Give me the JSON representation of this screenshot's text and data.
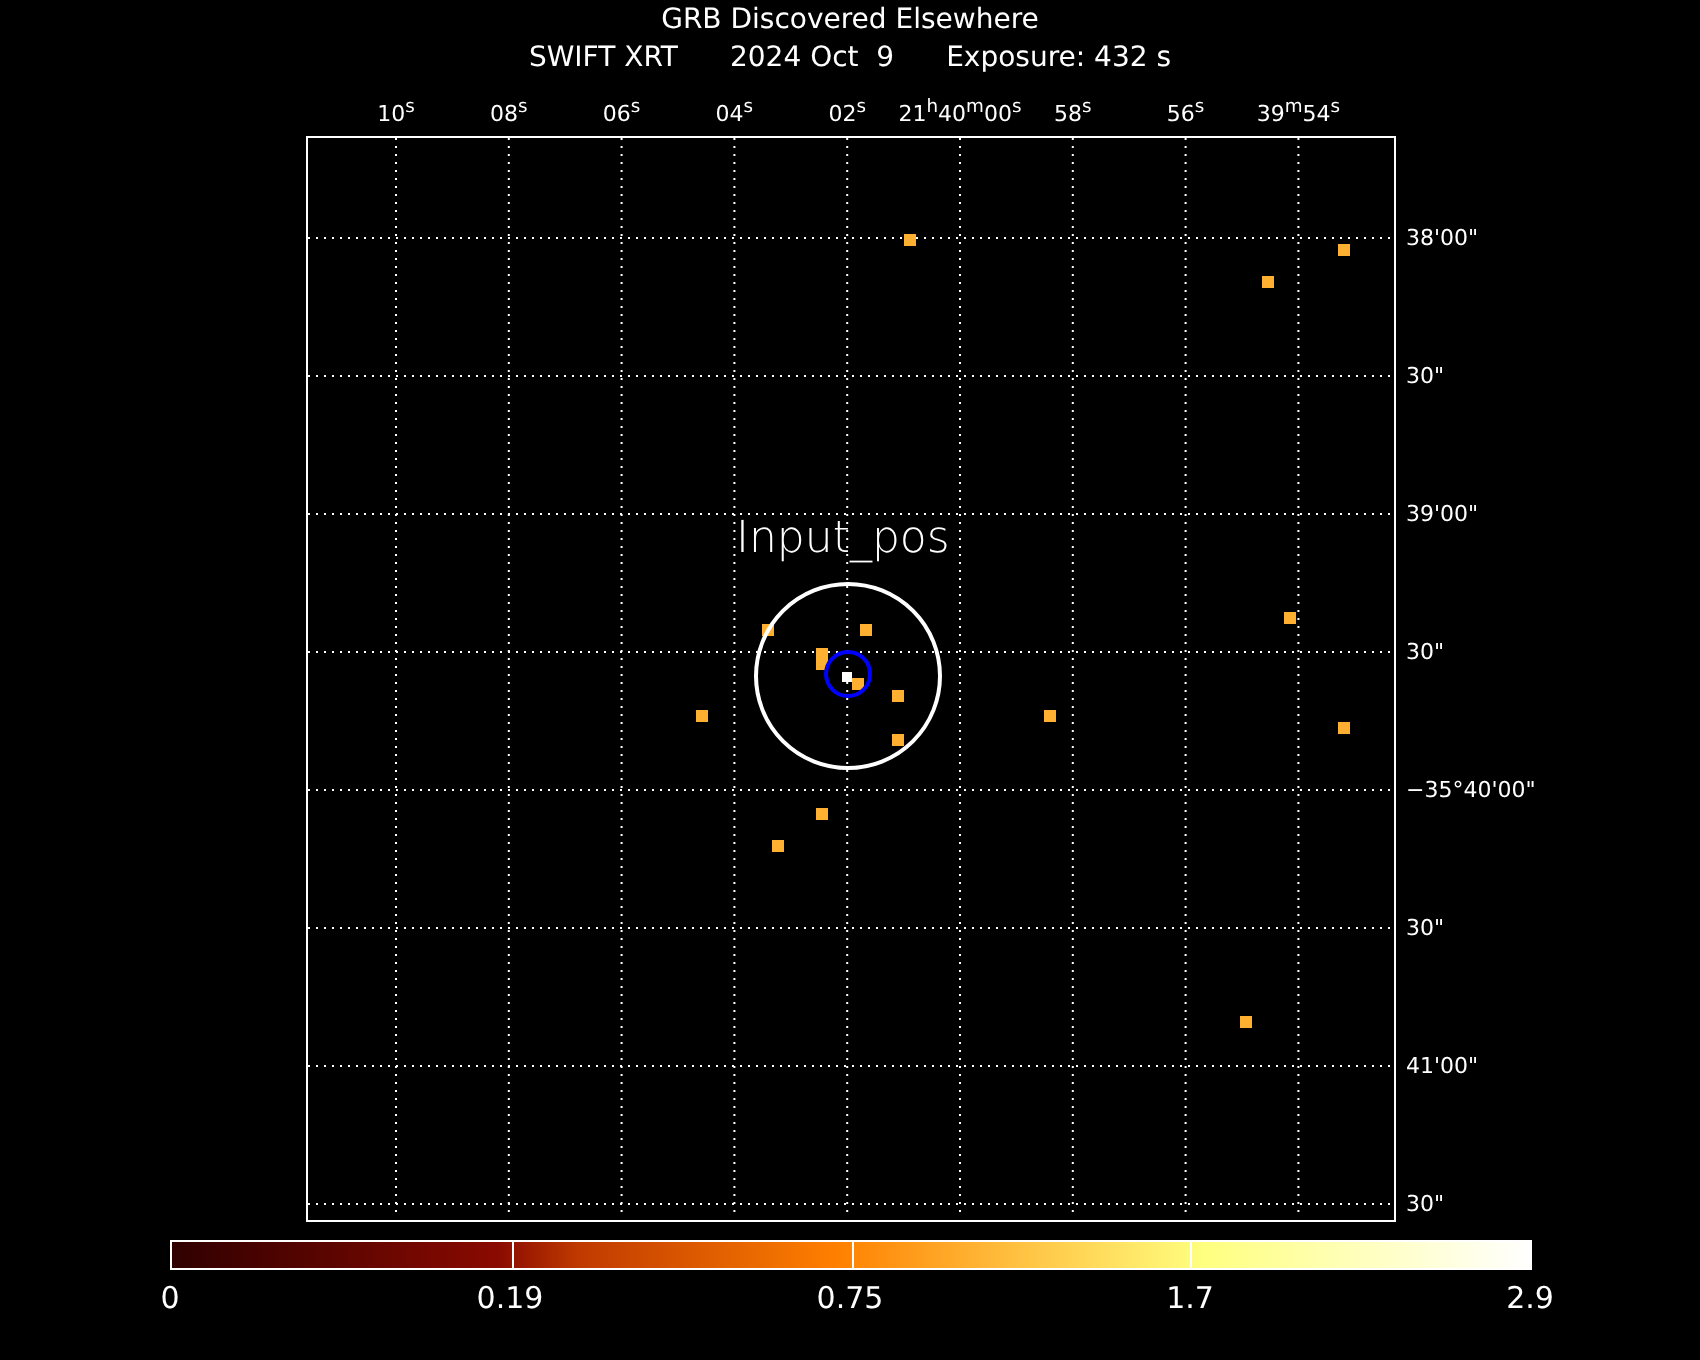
{
  "title": "GRB Discovered Elsewhere",
  "subtitle": [
    "SWIFT XRT",
    "2024 Oct  9",
    "Exposure: 432 s"
  ],
  "ra_ticks": [
    "10$^{s}$",
    "08$^{s}$",
    "06$^{s}$",
    "04$^{s}$",
    "02$^{s}$",
    "21$^{h}$40$^{m}$00$^{s}$",
    "58$^{s}$",
    "56$^{s}$",
    "39$^{m}$54$^{s}$"
  ],
  "dec_ticks": [
    "38'00\"",
    "30\"",
    "39'00\"",
    "30\"",
    "−35°40'00\"",
    "30\"",
    "41'00\"",
    "30\""
  ],
  "region_label": "Input_pos",
  "colorbar": {
    "labels": [
      "0",
      "0.19",
      "0.75",
      "1.7",
      "2.9"
    ]
  }
}
